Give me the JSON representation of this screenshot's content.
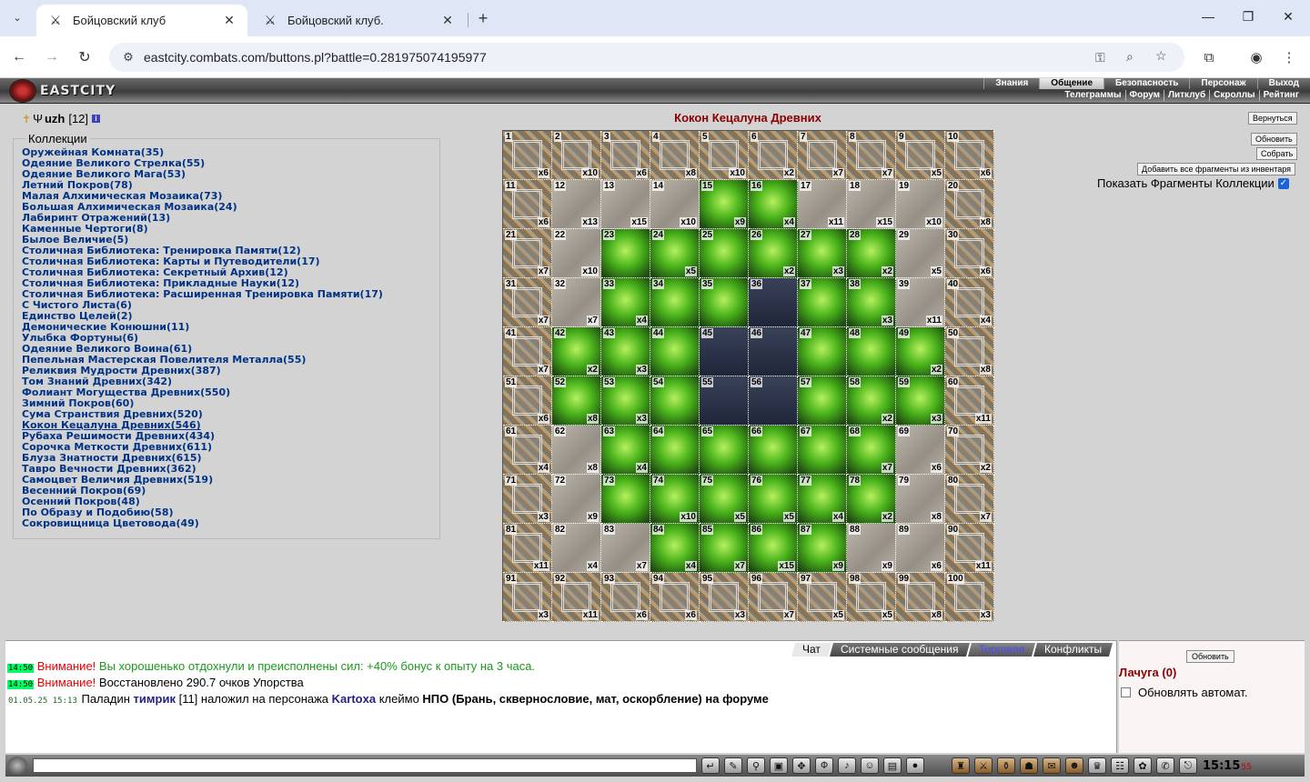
{
  "browser": {
    "tabs": [
      {
        "title": "Бойцовский клуб",
        "active": true
      },
      {
        "title": "Бойцовский клуб.",
        "active": false
      }
    ],
    "url": "eastcity.combats.com/buttons.pl?battle=0.281975074195977"
  },
  "header": {
    "logo_text": "EASTCITY",
    "nav_main": [
      "Знания",
      "Общение",
      "Безопасность",
      "Персонаж",
      "Выход"
    ],
    "nav_active": "Общение",
    "nav_sub": [
      "Телеграммы",
      "Форум",
      "Литклуб",
      "Скроллы",
      "Рейтинг"
    ]
  },
  "player": {
    "name": "uzh",
    "level": "[12]",
    "info": "i"
  },
  "collections": {
    "legend": "Коллекции",
    "selected": "Кокон Кецалуна Древних(546)",
    "items": [
      "Оружейная Комната(35)",
      "Одеяние Великого Стрелка(55)",
      "Одеяние Великого Мага(53)",
      "Летний Покров(78)",
      "Малая Алхимическая Мозаика(73)",
      "Большая Алхимическая Мозаика(24)",
      "Лабиринт Отражений(13)",
      "Каменные Чертоги(8)",
      "Былое Величие(5)",
      "Столичная Библиотека: Тренировка Памяти(12)",
      "Столичная Библиотека: Карты и Путеводители(17)",
      "Столичная Библиотека: Секретный Архив(12)",
      "Столичная Библиотека: Прикладные Науки(12)",
      "Столичная Библиотека: Расширенная Тренировка Памяти(17)",
      "С Чистого Листа(6)",
      "Единство Целей(2)",
      "Демонические Конюшни(11)",
      "Улыбка Фортуны(6)",
      "Одеяние Великого Воина(61)",
      "Пепельная Мастерская Повелителя Металла(55)",
      "Реликвия Мудрости Древних(387)",
      "Том Знаний Древних(342)",
      "Фолиант Могущества Древних(550)",
      "Зимний Покров(60)",
      "Сума Странствия Древних(520)",
      "Кокон Кецалуна Древних(546)",
      "Рубаха Решимости Древних(434)",
      "Сорочка Меткости Древних(611)",
      "Блуза Знатности Древних(615)",
      "Тавро Вечности Древних(362)",
      "Самоцвет Величия Древних(519)",
      "Весенний Покров(69)",
      "Осенний Покров(48)",
      "По Образу и Подобию(58)",
      "Сокровищница Цветовода(49)"
    ]
  },
  "board": {
    "title": "Кокон Кецалуна Древних",
    "counts": [
      "x6",
      "x10",
      "x6",
      "x8",
      "x10",
      "x2",
      "x7",
      "x7",
      "x5",
      "x6",
      "x6",
      "x13",
      "x15",
      "x10",
      "x9",
      "x4",
      "x11",
      "x15",
      "x10",
      "x8",
      "x7",
      "x10",
      "",
      "x5",
      "",
      "x2",
      "x3",
      "x2",
      "x5",
      "x6",
      "x7",
      "x7",
      "x4",
      "",
      "",
      "",
      "",
      "x3",
      "x11",
      "x4",
      "x7",
      "x2",
      "x3",
      "",
      "",
      "",
      "",
      "",
      "x2",
      "x8",
      "x6",
      "x8",
      "x3",
      "",
      "",
      "",
      "",
      "x2",
      "x3",
      "x11",
      "x4",
      "x8",
      "x4",
      "",
      "",
      "",
      "",
      "x7",
      "x6",
      "x2",
      "x3",
      "x9",
      "",
      "x10",
      "x5",
      "x5",
      "x4",
      "x2",
      "x8",
      "x7",
      "x11",
      "x4",
      "x7",
      "x4",
      "x7",
      "x15",
      "x9",
      "x9",
      "x6",
      "x11",
      "x3",
      "x11",
      "x6",
      "x6",
      "x3",
      "x7",
      "x5",
      "x5",
      "x8",
      "x3"
    ],
    "missing": [
      36,
      45,
      46,
      55,
      56
    ]
  },
  "right_panel": {
    "back_button": "Вернуться",
    "refresh_button": "Обновить",
    "collect_button": "Собрать",
    "add_all_button": "Добавить все фрагменты из инвентаря",
    "show_fragments_label": "Показать Фрагменты Коллекции",
    "show_fragments_checked": true
  },
  "chat": {
    "tabs": [
      "Чат",
      "Системные сообщения",
      "Торговля",
      "Конфликты"
    ],
    "active_tab": "Чат",
    "lines": [
      {
        "time": "14:50",
        "prefix": "Внимание!",
        "text": "Вы хорошенько отдохнули и преисполнены сил: +40% бонус к опыту на 3 часа."
      },
      {
        "time": "14:50",
        "prefix": "Внимание!",
        "text": "Восстановлено 290.7 очков Упорства"
      },
      {
        "time": "01.05.25 15:13",
        "pre": "Паладин",
        "user1": "тимрик",
        "lvl": "[11]",
        "mid": "наложил на персонажа",
        "user2": "Kartoxa",
        "mid2": "клеймо",
        "reason": "НПО (Брань, сквернословие, мат, оскорбление) на форуме"
      }
    ]
  },
  "online": {
    "refresh_button": "Обновить",
    "room": "Лачуга (0)",
    "auto_refresh_label": "Обновлять автомат.",
    "auto_refresh_checked": false
  },
  "clock": {
    "time": "15:15",
    "seconds": "55"
  }
}
